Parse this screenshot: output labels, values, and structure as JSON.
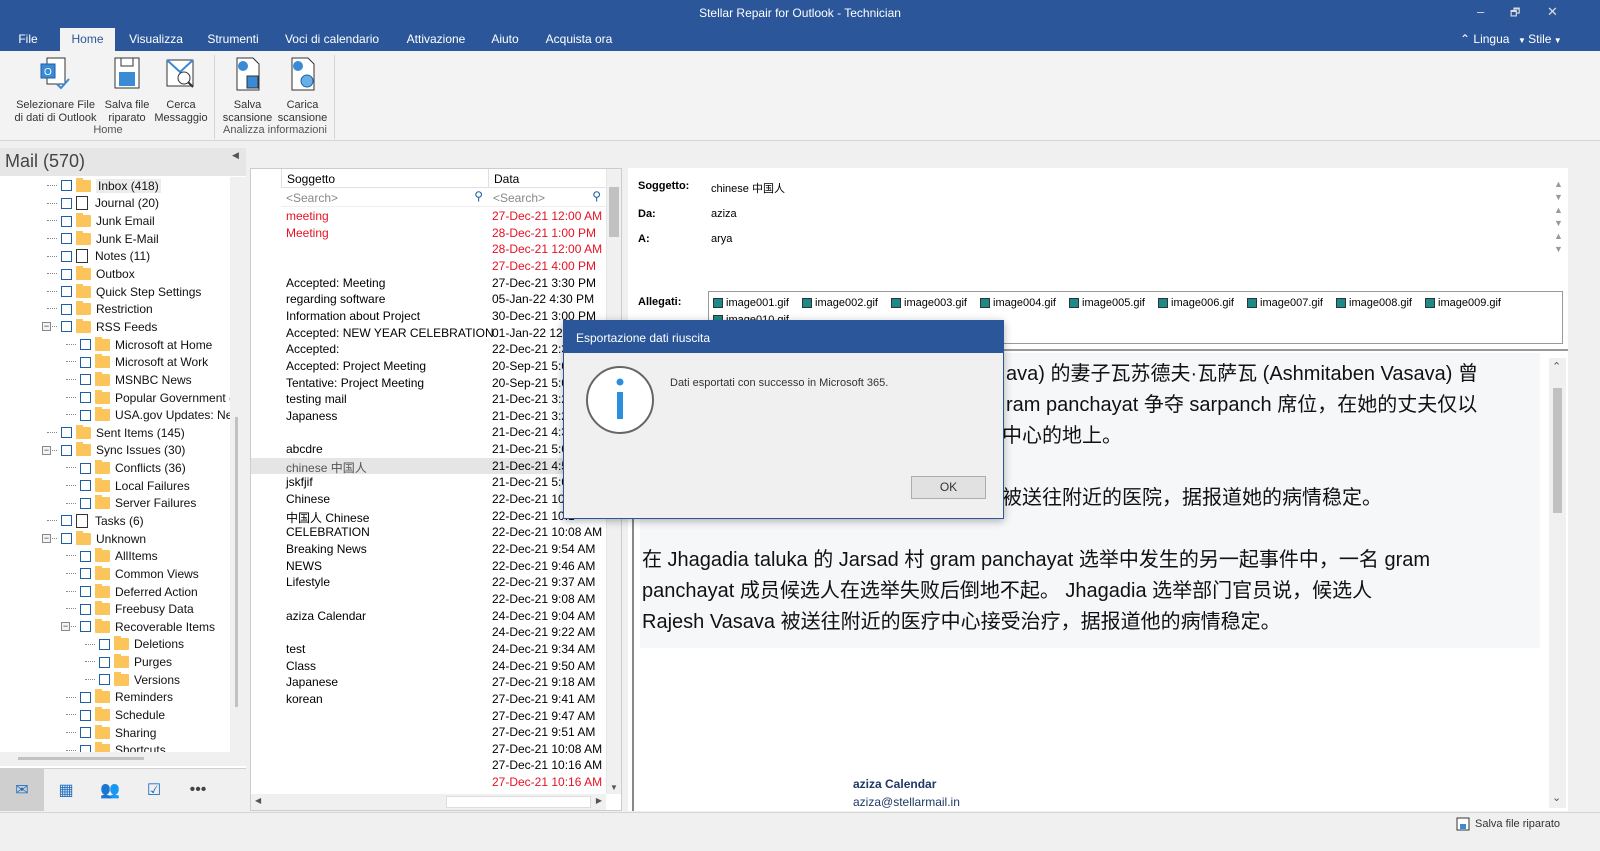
{
  "window": {
    "title": "Stellar Repair for Outlook - Technician",
    "minimize": "–",
    "restore": "🗗",
    "close": "✕"
  },
  "tabs": [
    "File",
    "Home",
    "Visualizza",
    "Strumenti",
    "Voci di calendario",
    "Attivazione",
    "Aiuto",
    "Acquista ora"
  ],
  "active_tab": "Home",
  "top_right": {
    "lingua": "Lingua",
    "stile": "Stile"
  },
  "ribbon": {
    "groups": [
      {
        "label": "Home",
        "buttons": [
          {
            "l1": "Selezionare File",
            "l2": "di dati di Outlook",
            "icon": "outlook-file-icon"
          },
          {
            "l1": "Salva file",
            "l2": "riparato",
            "icon": "save-icon"
          },
          {
            "l1": "Cerca",
            "l2": "Messaggio",
            "icon": "search-mail-icon"
          }
        ]
      },
      {
        "label": "Analizza informazioni",
        "buttons": [
          {
            "l1": "Salva",
            "l2": "scansione",
            "icon": "save-scan-icon"
          },
          {
            "l1": "Carica",
            "l2": "scansione",
            "icon": "load-scan-icon"
          }
        ]
      }
    ]
  },
  "sidebar": {
    "title": "Mail (570)",
    "tree": [
      {
        "label": "Inbox (418)",
        "level": 1,
        "icon": "inbox-icon",
        "selected": true
      },
      {
        "label": "Journal (20)",
        "level": 1,
        "icon": "journal-icon"
      },
      {
        "label": "Junk Email",
        "level": 1
      },
      {
        "label": "Junk E-Mail",
        "level": 1
      },
      {
        "label": "Notes (11)",
        "level": 1,
        "icon": "notes-icon"
      },
      {
        "label": "Outbox",
        "level": 1,
        "icon": "outbox-icon"
      },
      {
        "label": "Quick Step Settings",
        "level": 1
      },
      {
        "label": "Restriction",
        "level": 1
      },
      {
        "label": "RSS Feeds",
        "level": 1,
        "expanded": true
      },
      {
        "label": "Microsoft at Home",
        "level": 2
      },
      {
        "label": "Microsoft at Work",
        "level": 2
      },
      {
        "label": "MSNBC News",
        "level": 2
      },
      {
        "label": "Popular Government (",
        "level": 2
      },
      {
        "label": "USA.gov Updates: New",
        "level": 2
      },
      {
        "label": "Sent Items (145)",
        "level": 1,
        "icon": "sent-icon"
      },
      {
        "label": "Sync Issues (30)",
        "level": 1,
        "expanded": true
      },
      {
        "label": "Conflicts (36)",
        "level": 2
      },
      {
        "label": "Local Failures",
        "level": 2
      },
      {
        "label": "Server Failures",
        "level": 2
      },
      {
        "label": "Tasks (6)",
        "level": 1,
        "icon": "tasks-icon"
      },
      {
        "label": "Unknown",
        "level": 1,
        "expanded": true
      },
      {
        "label": "AllItems",
        "level": 2
      },
      {
        "label": "Common Views",
        "level": 2
      },
      {
        "label": "Deferred Action",
        "level": 2
      },
      {
        "label": "Freebusy Data",
        "level": 2
      },
      {
        "label": "Recoverable Items",
        "level": 2,
        "expanded": true
      },
      {
        "label": "Deletions",
        "level": 3
      },
      {
        "label": "Purges",
        "level": 3
      },
      {
        "label": "Versions",
        "level": 3
      },
      {
        "label": "Reminders",
        "level": 2
      },
      {
        "label": "Schedule",
        "level": 2
      },
      {
        "label": "Sharing",
        "level": 2
      },
      {
        "label": "Shortcuts",
        "level": 2
      }
    ],
    "nav": [
      {
        "icon": "mail-icon",
        "glyph": "✉"
      },
      {
        "icon": "calendar-icon",
        "glyph": "▦"
      },
      {
        "icon": "contacts-icon",
        "glyph": "👥"
      },
      {
        "icon": "tasks-icon",
        "glyph": "☑"
      },
      {
        "icon": "more-icon",
        "glyph": "•••"
      }
    ]
  },
  "list": {
    "col_subject": "Soggetto",
    "col_date": "Data",
    "search_placeholder": "<Search>",
    "rows": [
      {
        "s": "meeting",
        "d": "27-Dec-21 12:00 AM",
        "red": true
      },
      {
        "s": "Meeting",
        "d": "28-Dec-21 1:00 PM",
        "red": true
      },
      {
        "s": "",
        "d": "28-Dec-21 12:00 AM",
        "red": true
      },
      {
        "s": "",
        "d": "27-Dec-21 4:00 PM",
        "red": true
      },
      {
        "s": "Accepted: Meeting",
        "d": "27-Dec-21 3:30 PM"
      },
      {
        "s": "regarding software",
        "d": "05-Jan-22 4:30 PM"
      },
      {
        "s": "Information about Project",
        "d": "30-Dec-21 3:00 PM"
      },
      {
        "s": "Accepted: NEW YEAR CELEBRATION",
        "d": "01-Jan-22 12:00"
      },
      {
        "s": "Accepted:",
        "d": "22-Dec-21 2:30"
      },
      {
        "s": "Accepted: Project Meeting",
        "d": "20-Sep-21 5:00"
      },
      {
        "s": "Tentative: Project Meeting",
        "d": "20-Sep-21 5:00"
      },
      {
        "s": "testing mail",
        "d": "21-Dec-21 3:23"
      },
      {
        "s": "Japaness",
        "d": "21-Dec-21 3:26"
      },
      {
        "s": "",
        "d": "21-Dec-21 4:36"
      },
      {
        "s": "abcdre",
        "d": "21-Dec-21 5:05"
      },
      {
        "s": "chinese  中国人",
        "d": "21-Dec-21 4:56",
        "selected": true
      },
      {
        "s": "jskfjif",
        "d": "21-Dec-21 5:07"
      },
      {
        "s": "Chinese",
        "d": "22-Dec-21 10:5"
      },
      {
        "s": "中国人    Chinese",
        "d": "22-Dec-21 10:1"
      },
      {
        "s": "CELEBRATION",
        "d": "22-Dec-21 10:08 AM"
      },
      {
        "s": "Breaking News",
        "d": "22-Dec-21 9:54 AM"
      },
      {
        "s": "NEWS",
        "d": "22-Dec-21 9:46 AM"
      },
      {
        "s": "Lifestyle",
        "d": "22-Dec-21 9:37 AM"
      },
      {
        "s": "",
        "d": "22-Dec-21 9:08 AM"
      },
      {
        "s": "aziza Calendar",
        "d": "24-Dec-21 9:04 AM"
      },
      {
        "s": "",
        "d": "24-Dec-21 9:22 AM"
      },
      {
        "s": "test",
        "d": "24-Dec-21 9:34 AM"
      },
      {
        "s": "Class",
        "d": "24-Dec-21 9:50 AM"
      },
      {
        "s": "Japanese",
        "d": "27-Dec-21 9:18 AM"
      },
      {
        "s": "korean",
        "d": "27-Dec-21 9:41 AM"
      },
      {
        "s": "",
        "d": "27-Dec-21 9:47 AM"
      },
      {
        "s": "",
        "d": "27-Dec-21 9:51 AM"
      },
      {
        "s": "",
        "d": "27-Dec-21 10:08 AM"
      },
      {
        "s": "",
        "d": "27-Dec-21 10:16 AM"
      },
      {
        "s": "",
        "d": "27-Dec-21 10:16 AM",
        "red": true
      }
    ]
  },
  "message": {
    "subject_label": "Soggetto:",
    "subject": "chinese  中国人",
    "from_label": "Da:",
    "from": "aziza",
    "to_label": "A:",
    "to": "arya",
    "attachments_label": "Allegati:",
    "attachments": [
      "image001.gif",
      "image002.gif",
      "image003.gif",
      "image004.gif",
      "image005.gif",
      "image006.gif",
      "image007.gif",
      "image008.gif",
      "image009.gif",
      "image010.gif"
    ],
    "body_lines": [
      "ava) 的妻子瓦苏德夫·瓦萨瓦 (Ashmitaben Vasava) 曾",
      "ram panchayat 争夺 sarpanch 席位，在她的丈夫仅以",
      "中心的地上。",
      "被送往附近的医院，据报道她的病情稳定。",
      "在 Jhagadia taluka 的 Jarsad 村 gram panchayat 选举中发生的另一起事件中，一名 gram",
      "panchayat 成员候选人在选举失败后倒地不起。 Jhagadia 选举部门官员说，候选人",
      "Rajesh Vasava 被送往附近的医疗中心接受治疗，据报道他的病情稳定。"
    ],
    "signature_name": "aziza Calendar",
    "signature_email": "aziza@stellarmail.in"
  },
  "dialog": {
    "title": "Esportazione dati riuscita",
    "message": "Dati esportati con successo in Microsoft 365.",
    "ok": "OK",
    "icon": "info-icon"
  },
  "status": {
    "save_label": "Salva file riparato"
  },
  "colors": {
    "brand": "#2b579a",
    "red": "#e81123",
    "folder": "#fbc55b"
  }
}
